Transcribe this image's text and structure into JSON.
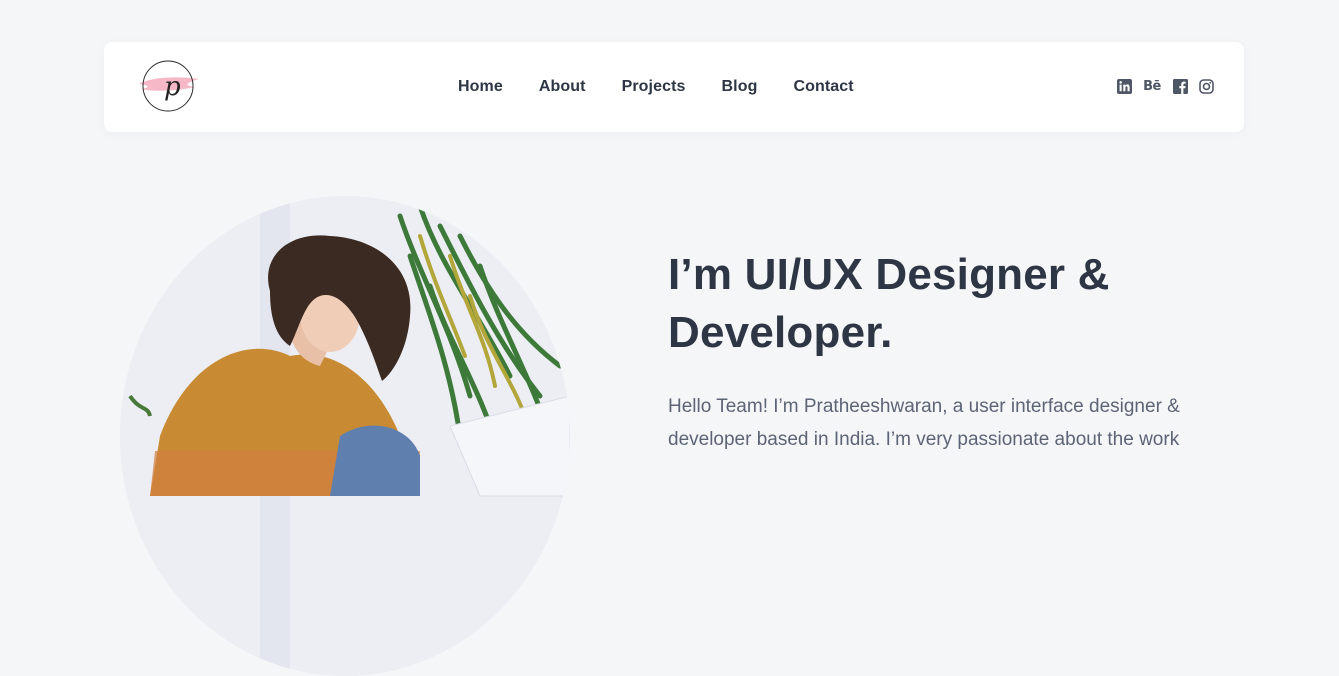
{
  "logo": {
    "letter": "p"
  },
  "nav": {
    "items": [
      {
        "label": "Home"
      },
      {
        "label": "About"
      },
      {
        "label": "Projects"
      },
      {
        "label": "Blog"
      },
      {
        "label": "Contact"
      }
    ]
  },
  "socials": [
    {
      "icon": "linkedin-icon"
    },
    {
      "icon": "behance-icon",
      "glyph": "Bē"
    },
    {
      "icon": "facebook-icon"
    },
    {
      "icon": "instagram-icon"
    }
  ],
  "hero": {
    "title": "I’m UI/UX Designer & Developer.",
    "description": "Hello Team! I’m Pratheeshwaran, a user interface designer & developer based in India. I’m very passionate about the work"
  },
  "colors": {
    "background": "#f5f6f8",
    "text": "#2e3645",
    "muted": "#5c6475",
    "logo_brush": "#f6b8c6"
  }
}
